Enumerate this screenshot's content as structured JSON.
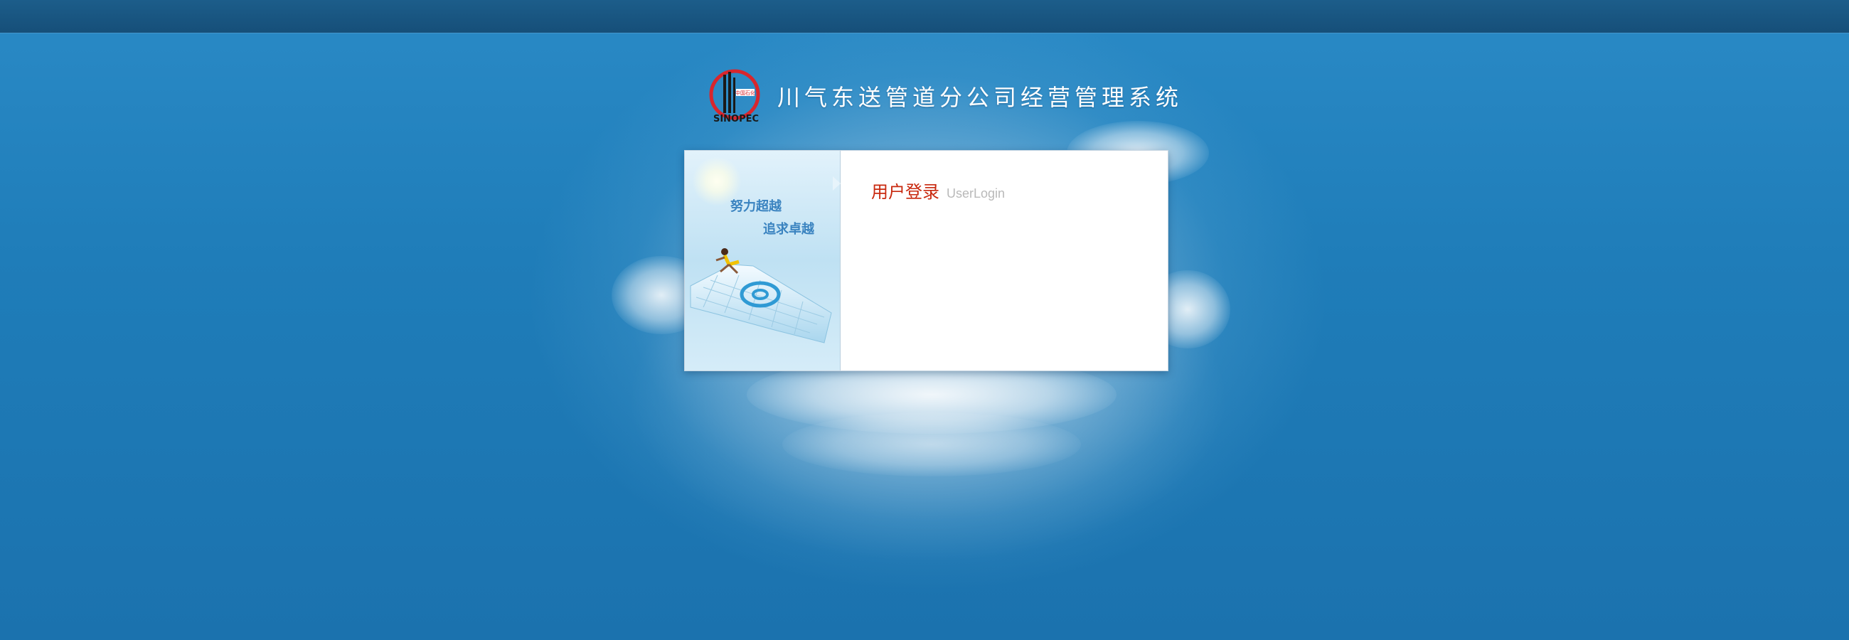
{
  "header": {
    "logo_text": "SINOPEC",
    "title": "川气东送管道分公司经营管理系统"
  },
  "banner": {
    "slogan_line1": "努力超越",
    "slogan_line2": "追求卓越"
  },
  "login": {
    "title": "用户登录",
    "subtitle": "UserLogin"
  },
  "colors": {
    "background": "#1f7db9",
    "top_strip": "#164f79",
    "title_text": "#ffffff",
    "login_title": "#c8280e",
    "login_subtitle": "#b9b9b9",
    "slogan": "#3a83c0",
    "logo_red": "#d8262d"
  }
}
